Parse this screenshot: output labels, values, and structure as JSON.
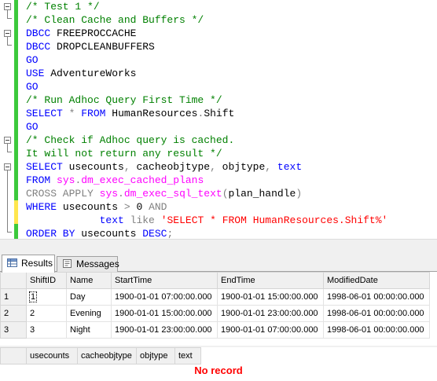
{
  "editor": {
    "lines": [
      [
        {
          "t": "/* Test 1 */",
          "c": "cm"
        }
      ],
      [
        {
          "t": "/* Clean Cache and Buffers */",
          "c": "cm"
        }
      ],
      [
        {
          "t": "DBCC",
          "c": "kw"
        },
        {
          "t": " FREEPROCCACHE",
          "c": ""
        }
      ],
      [
        {
          "t": "DBCC",
          "c": "kw"
        },
        {
          "t": " DROPCLEANBUFFERS",
          "c": ""
        }
      ],
      [
        {
          "t": "GO",
          "c": "kw"
        }
      ],
      [
        {
          "t": "USE",
          "c": "kw"
        },
        {
          "t": " AdventureWorks",
          "c": ""
        }
      ],
      [
        {
          "t": "GO",
          "c": "kw"
        }
      ],
      [
        {
          "t": "/* Run Adhoc Query First Time */",
          "c": "cm"
        }
      ],
      [
        {
          "t": "SELECT",
          "c": "kw"
        },
        {
          "t": " ",
          "c": ""
        },
        {
          "t": "*",
          "c": "gr"
        },
        {
          "t": " ",
          "c": ""
        },
        {
          "t": "FROM",
          "c": "kw"
        },
        {
          "t": " HumanResources",
          "c": ""
        },
        {
          "t": ".",
          "c": "gr"
        },
        {
          "t": "Shift",
          "c": ""
        }
      ],
      [
        {
          "t": "GO",
          "c": "kw"
        }
      ],
      [
        {
          "t": "/* Check if Adhoc query is cached.",
          "c": "cm"
        }
      ],
      [
        {
          "t": "It will not return any result */",
          "c": "cm"
        }
      ],
      [
        {
          "t": "SELECT",
          "c": "kw"
        },
        {
          "t": " usecounts",
          "c": ""
        },
        {
          "t": ",",
          "c": "gr"
        },
        {
          "t": " cacheobjtype",
          "c": ""
        },
        {
          "t": ",",
          "c": "gr"
        },
        {
          "t": " objtype",
          "c": ""
        },
        {
          "t": ",",
          "c": "gr"
        },
        {
          "t": " ",
          "c": ""
        },
        {
          "t": "text",
          "c": "kw"
        }
      ],
      [
        {
          "t": "FROM",
          "c": "kw"
        },
        {
          "t": " ",
          "c": ""
        },
        {
          "t": "sys",
          "c": "fn"
        },
        {
          "t": ".",
          "c": "gr"
        },
        {
          "t": "dm_exec_cached_plans",
          "c": "fn"
        }
      ],
      [
        {
          "t": "CROSS APPLY",
          "c": "gr"
        },
        {
          "t": " ",
          "c": ""
        },
        {
          "t": "sys",
          "c": "fn"
        },
        {
          "t": ".",
          "c": "gr"
        },
        {
          "t": "dm_exec_sql_text",
          "c": "fn"
        },
        {
          "t": "(",
          "c": "gr"
        },
        {
          "t": "plan_handle",
          "c": ""
        },
        {
          "t": ")",
          "c": "gr"
        }
      ],
      [
        {
          "t": "WHERE",
          "c": "kw"
        },
        {
          "t": " usecounts ",
          "c": ""
        },
        {
          "t": ">",
          "c": "gr"
        },
        {
          "t": " 0 ",
          "c": ""
        },
        {
          "t": "AND",
          "c": "gr"
        }
      ],
      [
        {
          "t": "            ",
          "c": ""
        },
        {
          "t": "text",
          "c": "kw"
        },
        {
          "t": " ",
          "c": ""
        },
        {
          "t": "like",
          "c": "gr"
        },
        {
          "t": " ",
          "c": ""
        },
        {
          "t": "'SELECT * FROM HumanResources.Shift%'",
          "c": "str"
        }
      ],
      [
        {
          "t": "ORDER BY",
          "c": "kw"
        },
        {
          "t": " usecounts ",
          "c": ""
        },
        {
          "t": "DESC",
          "c": "kw"
        },
        {
          "t": ";",
          "c": "gr"
        }
      ]
    ]
  },
  "tabs": {
    "results_label": "Results",
    "messages_label": "Messages"
  },
  "grid1": {
    "columns": [
      "ShiftID",
      "Name",
      "StartTime",
      "EndTime",
      "ModifiedDate"
    ],
    "rows": [
      [
        "1",
        "1",
        "Day",
        "1900-01-01 07:00:00.000",
        "1900-01-01 15:00:00.000",
        "1998-06-01 00:00:00.000"
      ],
      [
        "2",
        "2",
        "Evening",
        "1900-01-01 15:00:00.000",
        "1900-01-01 23:00:00.000",
        "1998-06-01 00:00:00.000"
      ],
      [
        "3",
        "3",
        "Night",
        "1900-01-01 23:00:00.000",
        "1900-01-01 07:00:00.000",
        "1998-06-01 00:00:00.000"
      ]
    ]
  },
  "grid2": {
    "columns": [
      "usecounts",
      "cacheobjtype",
      "objtype",
      "text"
    ],
    "no_record": "No record"
  },
  "colors": {
    "keyword": "#0000ff",
    "comment": "#008000",
    "string": "#ff0000",
    "function": "#ff00ff",
    "operator": "#808080",
    "change_marker": "#3cc93c",
    "no_record": "#ff0000"
  }
}
